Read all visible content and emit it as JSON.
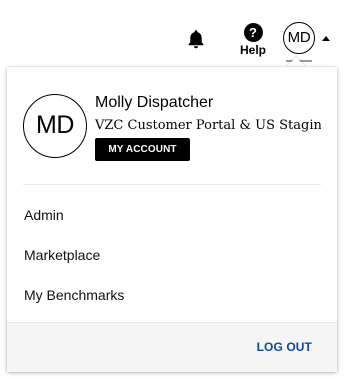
{
  "header": {
    "help_icon_glyph": "?",
    "help_label": "Help",
    "avatar_initials": "MD"
  },
  "profile_menu": {
    "avatar_initials": "MD",
    "user_name": "Molly Dispatcher",
    "organization": "VZC Customer Portal & US Staging...",
    "my_account_label": "MY ACCOUNT",
    "items": [
      {
        "label": "Admin"
      },
      {
        "label": "Marketplace"
      },
      {
        "label": "My Benchmarks"
      }
    ],
    "logout_label": "LOG OUT"
  },
  "icons": {
    "bell": "bell-icon",
    "help": "help-icon",
    "caret": "caret-up-icon"
  },
  "colors": {
    "logout_link": "#0b4a9e",
    "my_account_bg": "#000000",
    "footer_bg": "#f5f5f5"
  }
}
